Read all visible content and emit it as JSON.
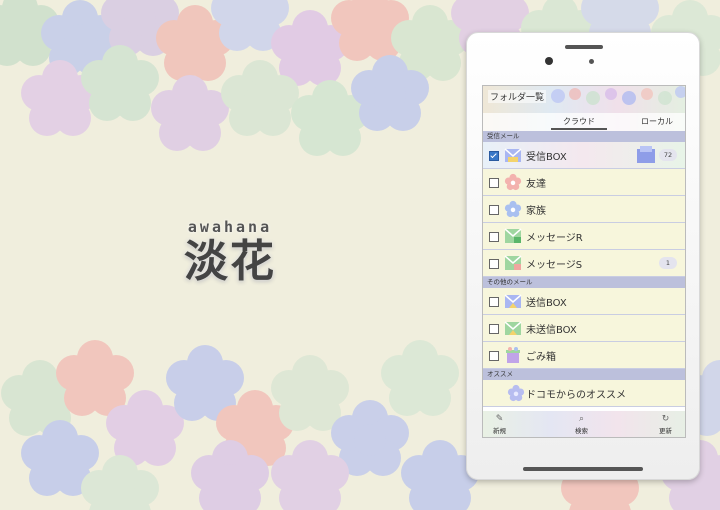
{
  "brand": {
    "subtitle": "awahana",
    "title": "淡花"
  },
  "screen": {
    "header_title": "フォルダ一覧",
    "tabs": [
      {
        "label": "クラウド",
        "active": true
      },
      {
        "label": "ローカル",
        "active": false
      }
    ],
    "sections": [
      {
        "label": "受信メール",
        "items": [
          {
            "label": "受信BOX",
            "badge": "72",
            "checked": true,
            "icon": "inbox-icon"
          },
          {
            "label": "友達",
            "badge": "",
            "checked": false,
            "icon": "flower-pink-icon"
          },
          {
            "label": "家族",
            "badge": "",
            "checked": false,
            "icon": "flower-blue-icon"
          },
          {
            "label": "メッセージR",
            "badge": "",
            "checked": false,
            "icon": "message-r-icon"
          },
          {
            "label": "メッセージS",
            "badge": "1",
            "checked": false,
            "icon": "message-s-icon"
          }
        ]
      },
      {
        "label": "その他のメール",
        "items": [
          {
            "label": "送信BOX",
            "checked": false,
            "icon": "outbox-icon"
          },
          {
            "label": "未送信BOX",
            "checked": false,
            "icon": "unsent-box-icon"
          },
          {
            "label": "ごみ箱",
            "checked": false,
            "icon": "trash-icon"
          }
        ]
      },
      {
        "label": "オススメ",
        "items": [
          {
            "label": "ドコモからのオススメ",
            "icon": "flower-recommend-icon"
          }
        ]
      }
    ],
    "footer": {
      "new_label": "新規",
      "search_label": "検索",
      "refresh_label": "更新"
    }
  },
  "colors": {
    "background": "#f0eedd",
    "section": "#bcc0dc",
    "row": "#f7f6dc",
    "checkbox": "#3a78c8"
  }
}
